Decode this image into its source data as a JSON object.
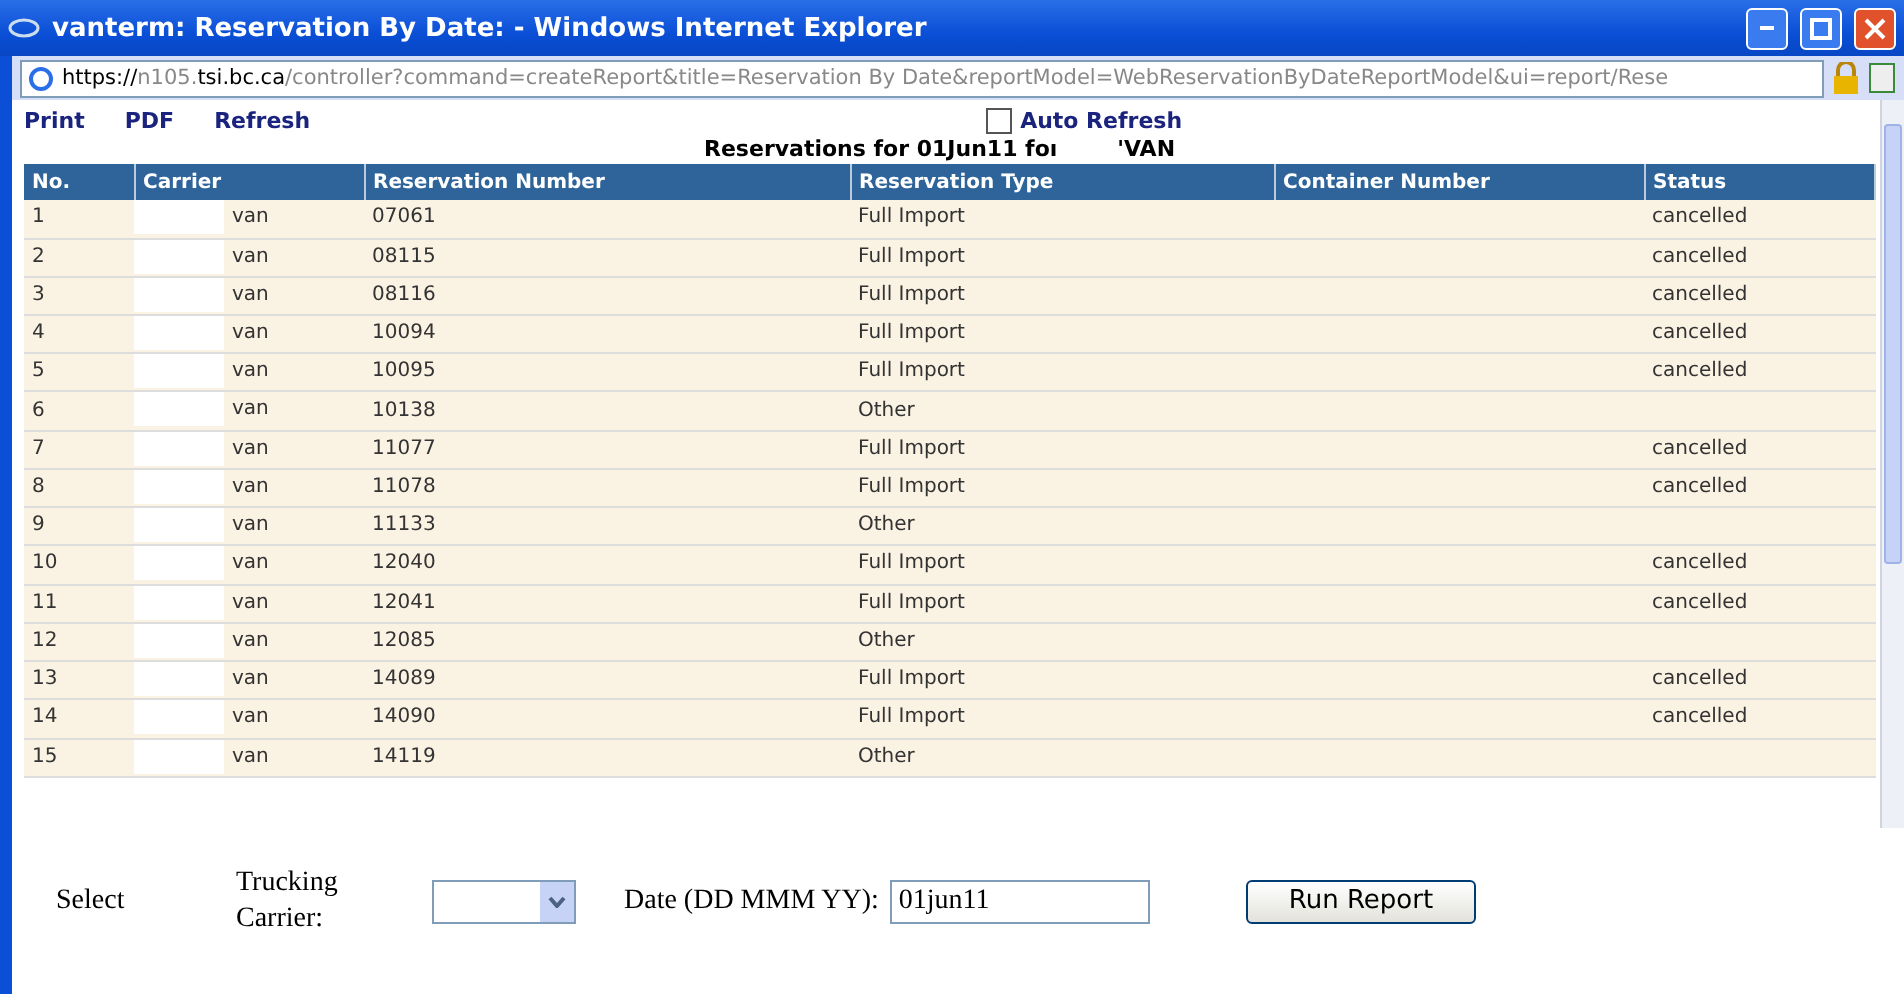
{
  "window": {
    "title": "vanterm: Reservation By Date: - Windows Internet Explorer"
  },
  "address": [
    {
      "text": "https://",
      "strong": true
    },
    {
      "text": "n105.",
      "strong": false
    },
    {
      "text": "tsi.bc.ca",
      "strong": true
    },
    {
      "text": "/controller?command=createReport&title=Reservation By Date&reportModel=WebReservationByDateReportModel&ui=report/Rese",
      "strong": false
    }
  ],
  "toolbar_links": [
    "Print",
    "PDF",
    "Refresh"
  ],
  "auto_refresh": {
    "label": "Auto Refresh",
    "checked": false
  },
  "report_title": {
    "text": "Reservations for  01Jun11 foı",
    "suffix": "'VAN"
  },
  "table": {
    "columns": [
      "No.",
      "Carrier",
      "Reservation Number",
      "Reservation Type",
      "Container Number",
      "Status"
    ],
    "rows": [
      {
        "no": "1",
        "carrier": "van",
        "number": "07061",
        "type": "Full Import",
        "container": "",
        "status": "cancelled"
      },
      {
        "no": "2",
        "carrier": "van",
        "number": "08115",
        "type": "Full Import",
        "container": "",
        "status": "cancelled"
      },
      {
        "no": "3",
        "carrier": "van",
        "number": "08116",
        "type": "Full Import",
        "container": "",
        "status": "cancelled"
      },
      {
        "no": "4",
        "carrier": "van",
        "number": "10094",
        "type": "Full Import",
        "container": "",
        "status": "cancelled"
      },
      {
        "no": "5",
        "carrier": "van",
        "number": "10095",
        "type": "Full Import",
        "container": "",
        "status": "cancelled"
      },
      {
        "no": "6",
        "carrier": "van",
        "number": "10138",
        "type": "Other",
        "container": "",
        "status": ""
      },
      {
        "no": "7",
        "carrier": "van",
        "number": "11077",
        "type": "Full Import",
        "container": "",
        "status": "cancelled"
      },
      {
        "no": "8",
        "carrier": "van",
        "number": "11078",
        "type": "Full Import",
        "container": "",
        "status": "cancelled"
      },
      {
        "no": "9",
        "carrier": "van",
        "number": "11133",
        "type": "Other",
        "container": "",
        "status": ""
      },
      {
        "no": "10",
        "carrier": "van",
        "number": "12040",
        "type": "Full Import",
        "container": "",
        "status": "cancelled"
      },
      {
        "no": "11",
        "carrier": "van",
        "number": "12041",
        "type": "Full Import",
        "container": "",
        "status": "cancelled"
      },
      {
        "no": "12",
        "carrier": "van",
        "number": "12085",
        "type": "Other",
        "container": "",
        "status": ""
      },
      {
        "no": "13",
        "carrier": "van",
        "number": "14089",
        "type": "Full Import",
        "container": "",
        "status": "cancelled"
      },
      {
        "no": "14",
        "carrier": "van",
        "number": "14090",
        "type": "Full Import",
        "container": "",
        "status": "cancelled"
      },
      {
        "no": "15",
        "carrier": "van",
        "number": "14119",
        "type": "Other",
        "container": "",
        "status": ""
      }
    ]
  },
  "form": {
    "select_label": "Select",
    "carrier_label": "Trucking Carrier:",
    "date_label": "Date (DD MMM YY):",
    "date_value": "01jun11",
    "button": "Run Report"
  }
}
